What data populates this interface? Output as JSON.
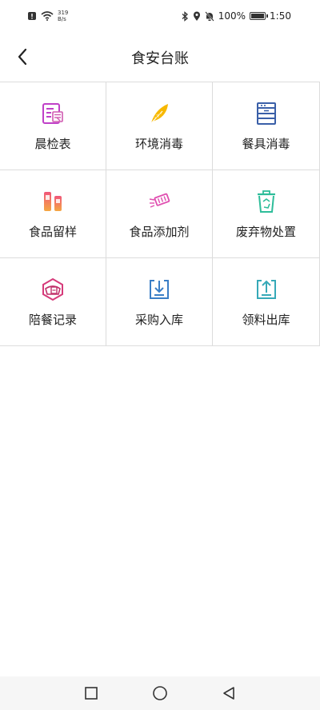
{
  "status_bar": {
    "net_speed_value": "319",
    "net_speed_unit": "B/s",
    "battery_percent": "100%",
    "time": "1:50"
  },
  "header": {
    "title": "食安台账"
  },
  "grid": {
    "items": [
      {
        "label": "晨检表",
        "icon": "morning-check-icon",
        "color": "#c040c8"
      },
      {
        "label": "环境消毒",
        "icon": "feather-icon",
        "color": "#f5b400"
      },
      {
        "label": "餐具消毒",
        "icon": "cabinet-icon",
        "color": "#3a5fa8"
      },
      {
        "label": "食品留样",
        "icon": "sample-bottles-icon",
        "color": "#f06a6a"
      },
      {
        "label": "食品添加剂",
        "icon": "additive-icon",
        "color": "#e04fb0"
      },
      {
        "label": "废弃物处置",
        "icon": "recycle-bin-icon",
        "color": "#2ebd9a"
      },
      {
        "label": "陪餐记录",
        "icon": "meal-record-icon",
        "color": "#d63a7a"
      },
      {
        "label": "采购入库",
        "icon": "download-box-icon",
        "color": "#3a7ec6"
      },
      {
        "label": "领料出库",
        "icon": "upload-box-icon",
        "color": "#36a9b8"
      }
    ]
  }
}
